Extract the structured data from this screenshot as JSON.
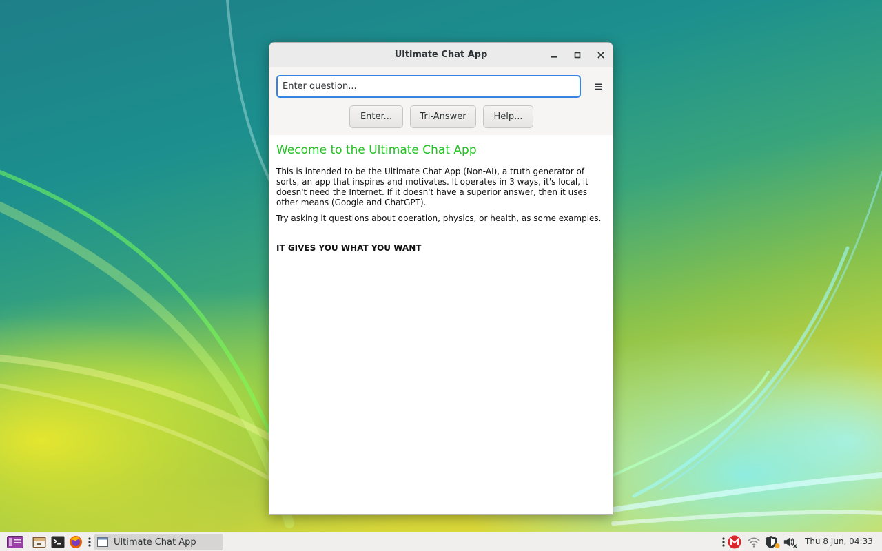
{
  "window": {
    "title": "Ultimate Chat App",
    "controls": {
      "minimize": "minimize",
      "maximize": "maximize",
      "close": "close"
    }
  },
  "toolbar": {
    "question_value": "Enter question... ",
    "enter_label": "Enter...",
    "tri_answer_label": "Tri-Answer",
    "help_label": "Help..."
  },
  "content": {
    "welcome": "Wecome to the Ultimate Chat App",
    "para1": "This is intended to be the Ultimate Chat App (Non-AI), a truth generator of sorts, an app that inspires and motivates. It operates in 3 ways, it's local, it doesn't need the Internet. If it doesn't have a superior answer, then it uses other means (Google and ChatGPT).",
    "para2": "Try asking it questions about operation, physics, or health, as some examples.",
    "slogan": "IT GIVES YOU WHAT YOU WANT"
  },
  "taskbar": {
    "task_label": "Ultimate Chat App",
    "clock": "Thu  8 Jun, 04:33"
  },
  "colors": {
    "accent": "#3584e4",
    "welcome_green": "#22c022",
    "mega_red": "#d9272e"
  }
}
